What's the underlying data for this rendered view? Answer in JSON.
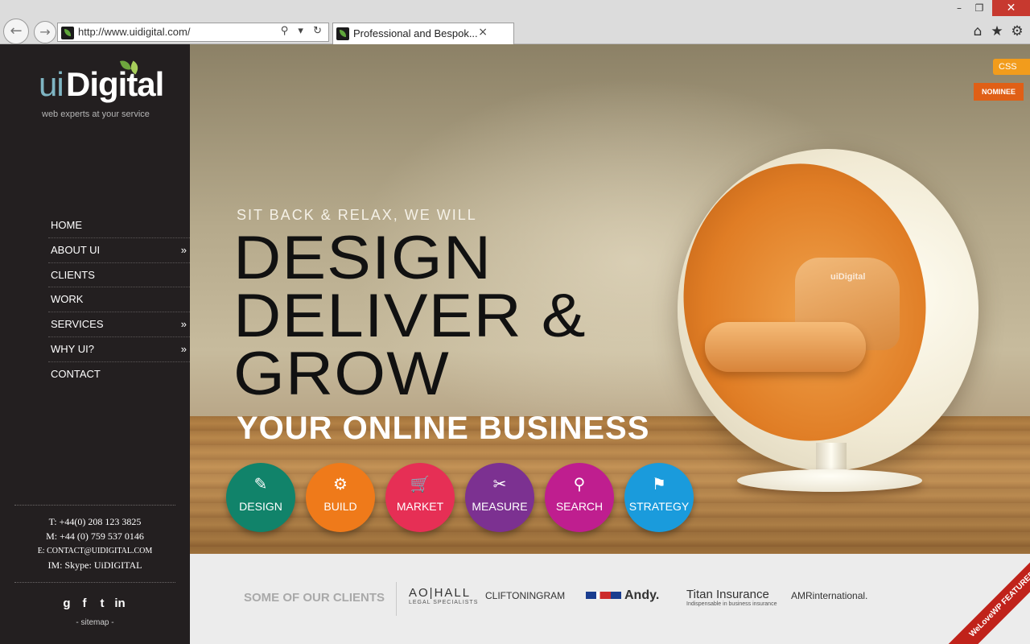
{
  "browser": {
    "url": "http://www.uidigital.com/",
    "tab_title": "Professional and Bespok...",
    "tab_close": "×",
    "back": "←",
    "forward": "→",
    "addr_icons": "⚲ ▾ ↻",
    "win_min": "–",
    "win_max": "❐",
    "win_close": "✕",
    "home_icon": "⌂",
    "star_icon": "★",
    "gear_icon": "⚙"
  },
  "sidebar": {
    "logo_ui": "ui",
    "logo_digital": "Digital",
    "tagline": "web experts at your service",
    "menu": [
      {
        "label": "HOME",
        "arrow": ""
      },
      {
        "label": "ABOUT UI",
        "arrow": "»"
      },
      {
        "label": "CLIENTS",
        "arrow": ""
      },
      {
        "label": "WORK",
        "arrow": ""
      },
      {
        "label": "SERVICES",
        "arrow": "»"
      },
      {
        "label": "WHY UI?",
        "arrow": "»"
      },
      {
        "label": "CONTACT",
        "arrow": ""
      }
    ],
    "contact": {
      "tel": "T: +44(0) 208 123 3825",
      "mobile": "M: +44 (0) 759 537 0146",
      "email": "E: CONTACT@UIDIGITAL.COM",
      "im": "IM: Skype: UiDIGITAL"
    },
    "social": {
      "google": "g",
      "facebook": "f",
      "twitter": "t",
      "linkedin": "in"
    },
    "sitemap": "- sitemap -"
  },
  "hero": {
    "subhead": "SIT BACK & RELAX, WE WILL",
    "line1": "DESIGN",
    "line2": "DELIVER &",
    "line3": "GROW",
    "business": "YOUR ONLINE BUSINESS",
    "chair_logo": "uiDigital",
    "services": [
      {
        "label": "DESIGN",
        "icon": "✎",
        "color": "#11836a"
      },
      {
        "label": "BUILD",
        "icon": "⚙",
        "color": "#ef7a1a"
      },
      {
        "label": "MARKET",
        "icon": "🛒",
        "color": "#e62f55"
      },
      {
        "label": "MEASURE",
        "icon": "✂",
        "color": "#7c3191"
      },
      {
        "label": "SEARCH",
        "icon": "⚲",
        "color": "#bf1e8f"
      },
      {
        "label": "STRATEGY",
        "icon": "⚑",
        "color": "#1a9bdc"
      }
    ],
    "css_badge": "CSS",
    "nominee_badge": "NOMINEE"
  },
  "clients": {
    "title": "SOME OF OUR CLIENTS",
    "aohall": "AO|HALL",
    "aohall_sub": "LEGAL SPECIALISTS",
    "clifton": "CLIFTONINGRAM",
    "andy": "Andy.",
    "titan": "Titan Insurance",
    "titan_sub": "Indispensable in business insurance",
    "amr": "AMRinternational.",
    "featured": "WeLoveWP FEATURED"
  }
}
